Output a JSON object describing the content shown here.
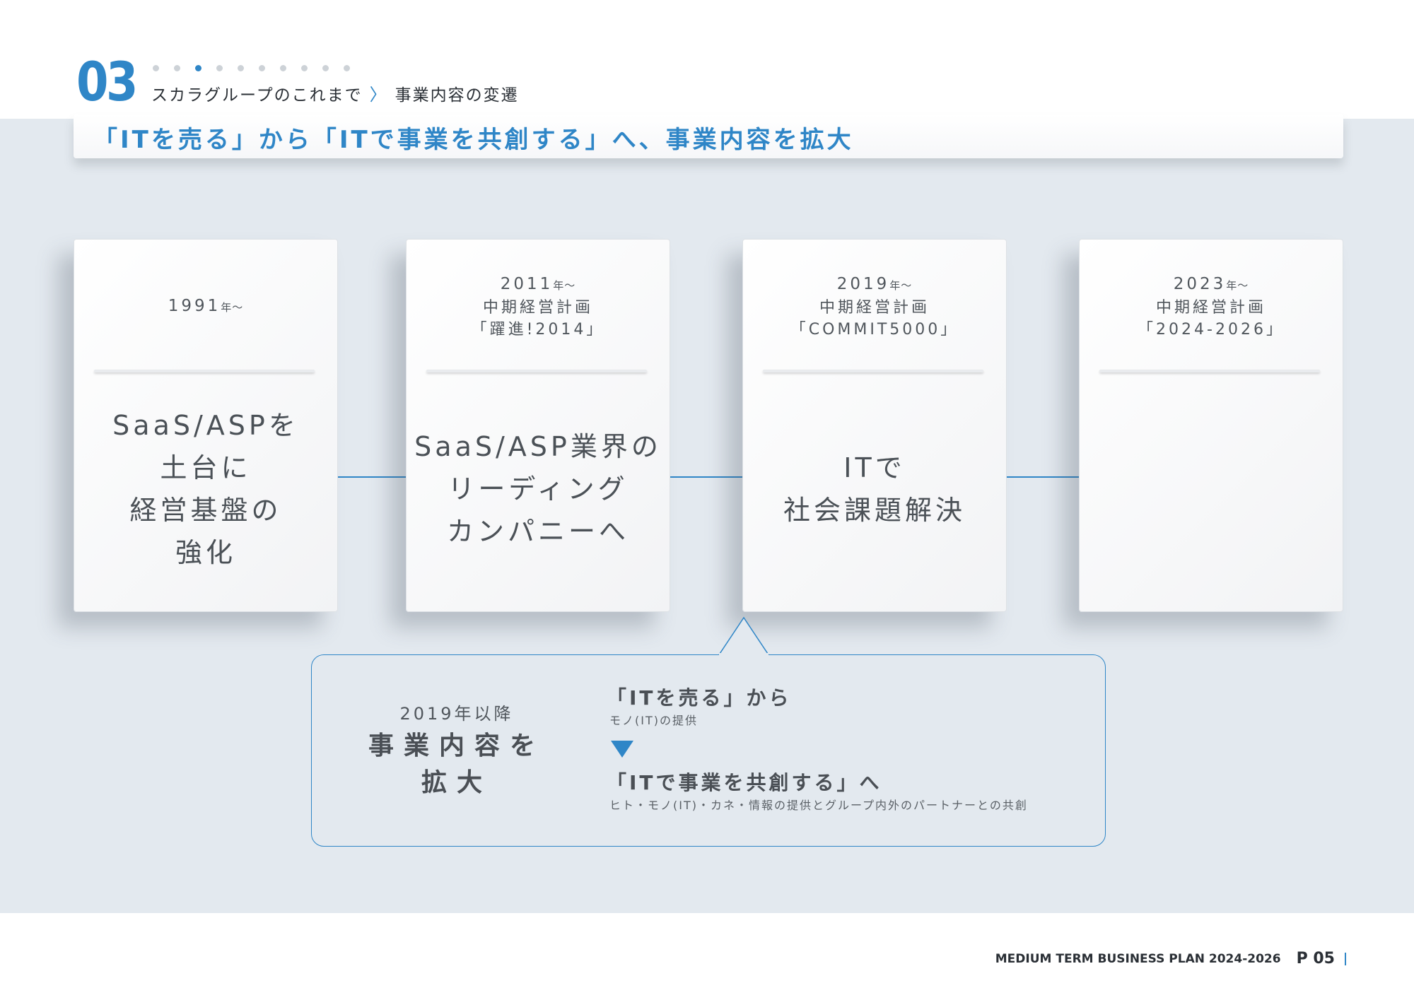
{
  "header": {
    "section_number": "03",
    "breadcrumb_parent": "スカラグループのこれまで",
    "breadcrumb_separator": "〉",
    "breadcrumb_current": "事業内容の変遷",
    "headline": "「ITを売る」から「ITで事業を共創する」へ、事業内容を拡大",
    "progress": {
      "total": 10,
      "current": 3
    }
  },
  "timeline": [
    {
      "year": "1991",
      "year_suffix": "年〜",
      "plan": "",
      "plan_name": "",
      "lines": [
        "SaaS/ASPを",
        "土台に",
        "経営基盤の",
        "強化"
      ]
    },
    {
      "year": "2011",
      "year_suffix": "年〜",
      "plan": "中期経営計画",
      "plan_name": "「躍進!2014」",
      "lines": [
        "SaaS/ASP業界の",
        "リーディング",
        "カンパニーへ"
      ]
    },
    {
      "year": "2019",
      "year_suffix": "年〜",
      "plan": "中期経営計画",
      "plan_name": "「COMMIT5000」",
      "lines": [
        "ITで",
        "社会課題解決"
      ]
    },
    {
      "year": "2023",
      "year_suffix": "年〜",
      "plan": "中期経営計画",
      "plan_name": "「2024-2026」",
      "lines": []
    }
  ],
  "callout": {
    "year": "2019年以降",
    "title_line1": "事業内容を",
    "title_line2": "拡大",
    "from_label": "「ITを売る」から",
    "from_sub": "モノ(IT)の提供",
    "to_label": "「ITで事業を共創する」へ",
    "to_sub": "ヒト・モノ(IT)・カネ・情報の提供とグループ内外のパートナーとの共創"
  },
  "footer": {
    "document": "MEDIUM TERM BUSINESS PLAN 2024-2026",
    "page": "P 05"
  },
  "colors": {
    "accent": "#2f86c7",
    "band": "#e3e9ef",
    "text": "#4b5157"
  }
}
